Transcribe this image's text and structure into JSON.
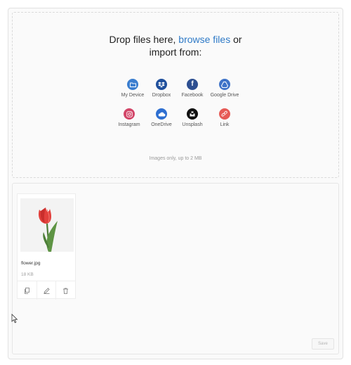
{
  "uploader": {
    "headline_prefix": "Drop files here, ",
    "browse_label": "browse files",
    "headline_suffix": " or",
    "headline_line2": "import from:",
    "hint": "Images only, up to 2 MB",
    "sources": [
      {
        "label": "My Device",
        "icon": "folder-icon",
        "color": "#3b7ecf"
      },
      {
        "label": "Dropbox",
        "icon": "dropbox-icon",
        "color": "#1f4f9c"
      },
      {
        "label": "Facebook",
        "icon": "facebook-icon",
        "color": "#2d4f91"
      },
      {
        "label": "Google Drive",
        "icon": "google-drive-icon",
        "color": "#3f73c8"
      },
      {
        "label": "Instagram",
        "icon": "instagram-icon",
        "color": "#d24467"
      },
      {
        "label": "OneDrive",
        "icon": "onedrive-icon",
        "color": "#2e6fd1"
      },
      {
        "label": "Unsplash",
        "icon": "unsplash-icon",
        "color": "#111111"
      },
      {
        "label": "Link",
        "icon": "link-icon",
        "color": "#e65a56"
      }
    ]
  },
  "file": {
    "name": "flower.jpg",
    "size": "18 KB",
    "actions": [
      "copy-icon",
      "edit-icon",
      "trash-icon"
    ]
  },
  "footer": {
    "save_label": "Save"
  }
}
